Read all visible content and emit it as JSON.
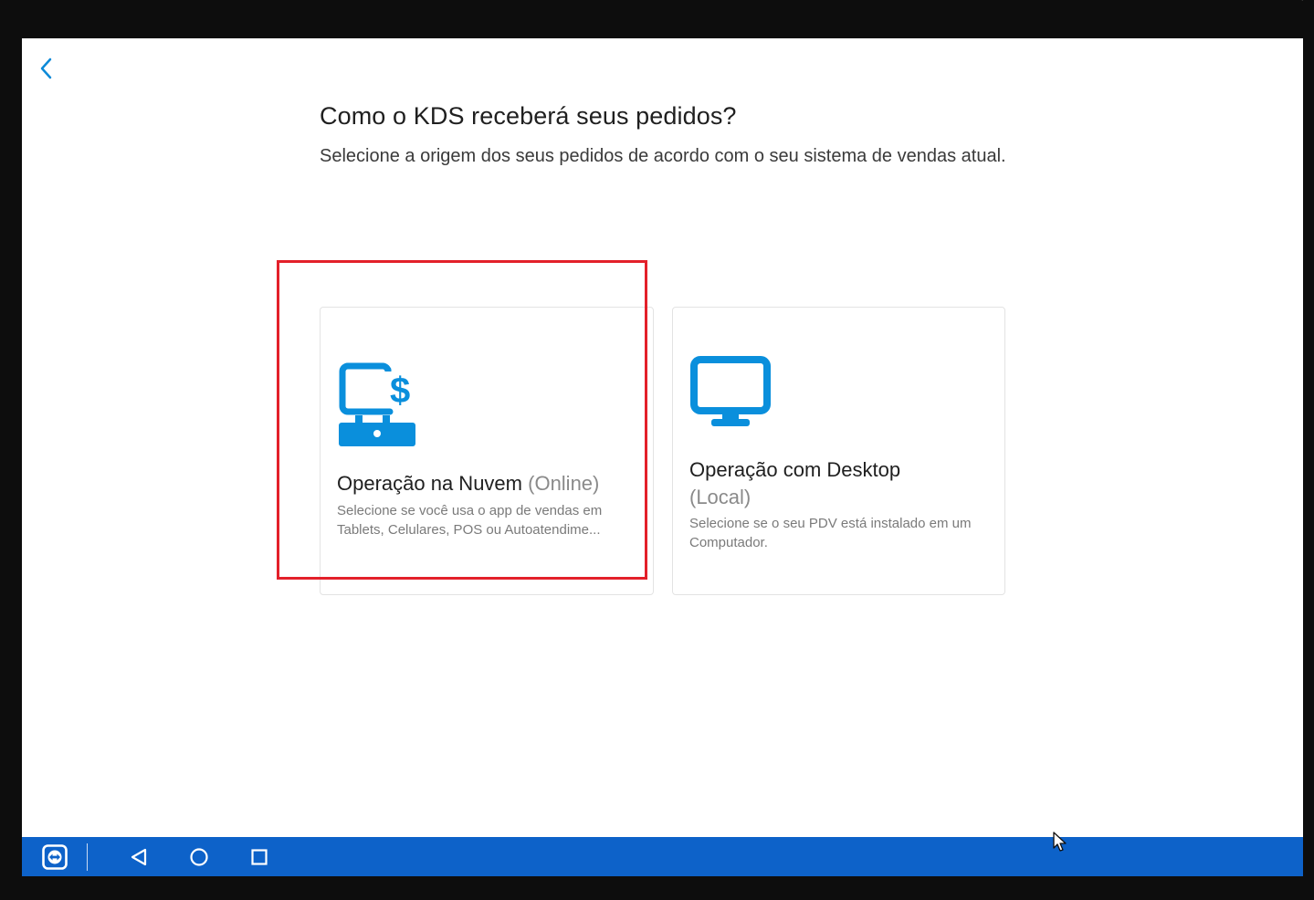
{
  "page": {
    "title": "Como o KDS receberá seus pedidos?",
    "subtitle": "Selecione a origem dos seus pedidos de acordo com o seu sistema de vendas atual."
  },
  "options": [
    {
      "title": "Operação na Nuvem",
      "qualifier": "(Online)",
      "description": "Selecione se você usa o app de vendas em Tablets, Celulares, POS ou Autoatendime...",
      "icon": "cloud-pos-icon",
      "selected": true
    },
    {
      "title": "Operação com Desktop",
      "qualifier": "(Local)",
      "description": "Selecione se o seu PDV está instalado em um Computador.",
      "icon": "desktop-monitor-icon",
      "selected": false
    }
  ],
  "navbar": {
    "icons": [
      "teamviewer-icon",
      "back-triangle-icon",
      "home-circle-icon",
      "recents-square-icon"
    ]
  },
  "colors": {
    "accent": "#0c8ad8",
    "icon_blue": "#0a8fdc",
    "navbar": "#0d62c9",
    "highlight": "#e3202a"
  }
}
